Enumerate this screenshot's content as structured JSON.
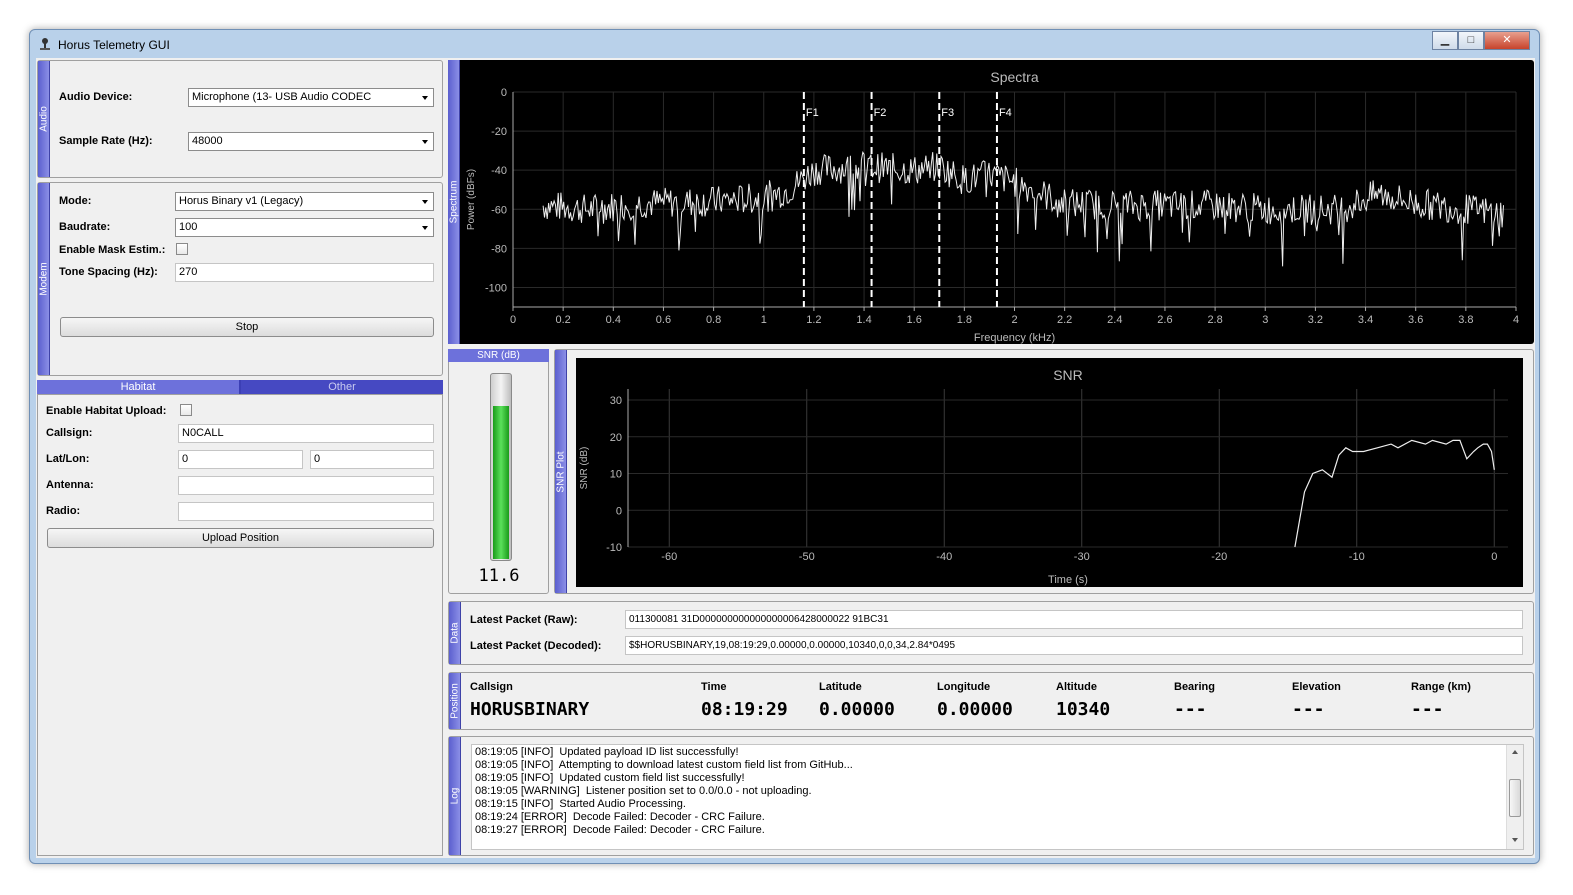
{
  "window": {
    "title": "Horus Telemetry GUI",
    "controls": {
      "minimize": "▁",
      "maximize": "□",
      "close": "✕"
    }
  },
  "audio": {
    "group": "Audio",
    "device_label": "Audio Device:",
    "device_value": "Microphone (13- USB Audio CODEC",
    "rate_label": "Sample Rate (Hz):",
    "rate_value": "48000"
  },
  "modem": {
    "group": "Modem",
    "mode_label": "Mode:",
    "mode_value": "Horus Binary v1 (Legacy)",
    "baud_label": "Baudrate:",
    "baud_value": "100",
    "mask_label": "Enable Mask Estim.:",
    "mask_checked": false,
    "tone_label": "Tone Spacing (Hz):",
    "tone_value": "270",
    "stop_label": "Stop"
  },
  "habitat": {
    "tabs": [
      "Habitat",
      "Other"
    ],
    "upload_label": "Enable Habitat Upload:",
    "upload_checked": false,
    "callsign_label": "Callsign:",
    "callsign_value": "N0CALL",
    "latlon_label": "Lat/Lon:",
    "lat_value": "0",
    "lon_value": "0",
    "antenna_label": "Antenna:",
    "antenna_value": "",
    "radio_label": "Radio:",
    "radio_value": "",
    "upload_btn": "Upload Position"
  },
  "spectrum": {
    "group": "Spectrum",
    "markers": [
      "F1",
      "F2",
      "F3",
      "F4"
    ]
  },
  "snr_meter": {
    "header": "SNR (dB)",
    "value": "11.6",
    "level_fraction": 0.83
  },
  "snr_plot": {
    "group": "SNR Plot"
  },
  "data": {
    "group": "Data",
    "raw_label": "Latest Packet (Raw):",
    "raw_value": "011300081 31D000000000000000006428000022 91BC31",
    "decoded_label": "Latest Packet (Decoded):",
    "decoded_value": "$$HORUSBINARY,19,08:19:29,0.00000,0.00000,10340,0,0,34,2.84*0495"
  },
  "position": {
    "group": "Position",
    "headers": [
      "Callsign",
      "Time",
      "Latitude",
      "Longitude",
      "Altitude",
      "Bearing",
      "Elevation",
      "Range (km)"
    ],
    "values": [
      "HORUSBINARY",
      "08:19:29",
      "0.00000",
      "0.00000",
      "10340",
      "---",
      "---",
      "---"
    ]
  },
  "log": {
    "group": "Log",
    "lines": [
      "08:19:05 [INFO]  Updated payload ID list successfully!",
      "08:19:05 [INFO]  Attempting to download latest custom field list from GitHub...",
      "08:19:05 [INFO]  Updated custom field list successfully!",
      "08:19:05 [WARNING]  Listener position set to 0.0/0.0 - not uploading.",
      "08:19:15 [INFO]  Started Audio Processing.",
      "08:19:24 [ERROR]  Decode Failed: Decoder - CRC Failure.",
      "08:19:27 [ERROR]  Decode Failed: Decoder - CRC Failure."
    ]
  },
  "chart_data": [
    {
      "type": "line",
      "title": "Spectra",
      "xlabel": "Frequency (kHz)",
      "ylabel": "Power (dBFs)",
      "xlim": [
        0,
        4
      ],
      "ylim": [
        -110,
        0
      ],
      "xticks": [
        "0",
        "0.2",
        "0.4",
        "0.6",
        "0.8",
        "1",
        "1.2",
        "1.4",
        "1.6",
        "1.8",
        "2",
        "2.2",
        "2.4",
        "2.6",
        "2.8",
        "3",
        "3.2",
        "3.4",
        "3.6",
        "3.8",
        "4"
      ],
      "yticks": [
        "0",
        "-20",
        "-40",
        "-60",
        "-80",
        "-100"
      ],
      "markers": [
        {
          "label": "F1",
          "x": 1.16
        },
        {
          "label": "F2",
          "x": 1.43
        },
        {
          "label": "F3",
          "x": 1.7
        },
        {
          "label": "F4",
          "x": 1.93
        }
      ],
      "envelope": {
        "x": [
          0.12,
          0.3,
          0.5,
          0.8,
          1.0,
          1.1,
          1.2,
          1.4,
          1.6,
          1.7,
          1.8,
          1.9,
          2.0,
          2.2,
          2.5,
          2.8,
          3.0,
          3.3,
          3.45,
          3.6,
          3.8,
          3.95
        ],
        "y": [
          -58,
          -60,
          -57,
          -56,
          -54,
          -50,
          -40,
          -38,
          -40,
          -38,
          -45,
          -42,
          -46,
          -57,
          -58,
          -58,
          -60,
          -60,
          -52,
          -57,
          -60,
          -62
        ]
      }
    },
    {
      "type": "line",
      "title": "SNR",
      "xlabel": "Time (s)",
      "ylabel": "SNR (dB)",
      "xlim": [
        -63,
        1
      ],
      "ylim": [
        -10,
        33
      ],
      "xticks": [
        "-60",
        "-50",
        "-40",
        "-30",
        "-20",
        "-10",
        "0"
      ],
      "yticks": [
        "30",
        "20",
        "10",
        "0",
        "-10"
      ],
      "series": [
        {
          "x": [
            -14.5,
            -13.8,
            -13.2,
            -12.5,
            -11.8,
            -11.3,
            -10.8,
            -10.3,
            -9.5,
            -8.5,
            -7.5,
            -7,
            -6,
            -5,
            -4.5,
            -3.5,
            -3,
            -2.5,
            -2,
            -1.5,
            -1.2,
            -0.8,
            -0.5,
            -0.2,
            0
          ],
          "y": [
            -10,
            5,
            10,
            11,
            9,
            15,
            17,
            16,
            16,
            17,
            18,
            17,
            19,
            18,
            19,
            18,
            19,
            19,
            14,
            16,
            17,
            18,
            18,
            16,
            11
          ]
        }
      ]
    }
  ]
}
